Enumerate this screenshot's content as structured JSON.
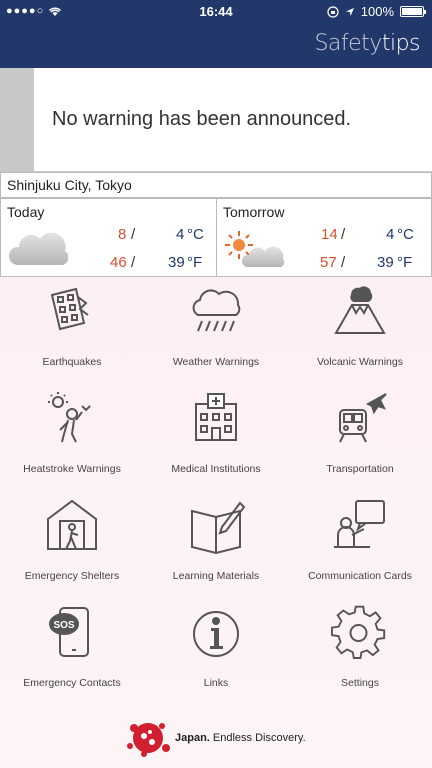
{
  "status": {
    "signal_dots": "●●●●○",
    "time": "16:44",
    "battery": "100%"
  },
  "header": {
    "title_part1": "Safety",
    "title_part2": "tips"
  },
  "warning": {
    "text": "No warning has been announced."
  },
  "location": {
    "name": "Shinjuku City, Tokyo"
  },
  "weather": {
    "today": {
      "label": "Today",
      "high_c": "8",
      "low_c": "4",
      "high_f": "46",
      "low_f": "39",
      "icon": "cloud-icon"
    },
    "tomorrow": {
      "label": "Tomorrow",
      "high_c": "14",
      "low_c": "4",
      "high_f": "57",
      "low_f": "39",
      "icon": "sun-cloud-icon"
    },
    "unit_c": "°C",
    "unit_f": "°F",
    "slash": "/"
  },
  "menu": [
    {
      "label": "Earthquakes",
      "icon": "earthquake-icon"
    },
    {
      "label": "Weather Warnings",
      "icon": "rain-cloud-icon"
    },
    {
      "label": "Volcanic Warnings",
      "icon": "volcano-icon"
    },
    {
      "label": "Heatstroke Warnings",
      "icon": "heatstroke-icon"
    },
    {
      "label": "Medical Institutions",
      "icon": "hospital-icon"
    },
    {
      "label": "Transportation",
      "icon": "transportation-icon"
    },
    {
      "label": "Emergency Shelters",
      "icon": "shelter-icon"
    },
    {
      "label": "Learning Materials",
      "icon": "book-icon"
    },
    {
      "label": "Communication Cards",
      "icon": "communication-icon"
    },
    {
      "label": "Emergency Contacts",
      "icon": "sos-phone-icon"
    },
    {
      "label": "Links",
      "icon": "info-icon"
    },
    {
      "label": "Settings",
      "icon": "gear-icon"
    }
  ],
  "footer": {
    "brand_bold": "Japan.",
    "brand_rest": " Endless Discovery."
  },
  "colors": {
    "nav": "#22386a",
    "accent_red": "#d9502e",
    "background": "#fdf0f3"
  }
}
